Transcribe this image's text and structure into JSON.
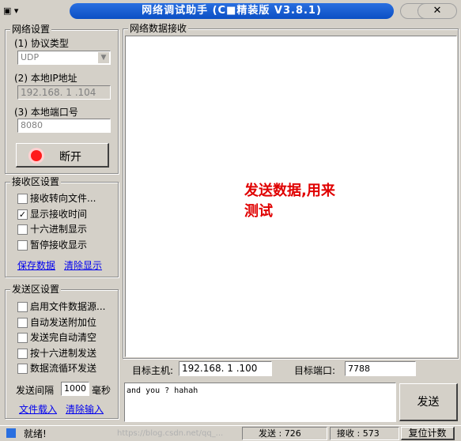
{
  "window": {
    "title": "网络调试助手 (C■精装版 V3.8.1)",
    "app_icon": "▣ ▾",
    "btn_back": "⬅",
    "btn_close": "✕"
  },
  "network": {
    "group_label": "网络设置",
    "protocol_label": "(1) 协议类型",
    "protocol_value": "UDP",
    "ip_label": "(2) 本地IP地址",
    "ip_value": "192.168. 1 .104",
    "port_label": "(3) 本地端口号",
    "port_value": "8080",
    "connect_button": "断开"
  },
  "receive": {
    "group_label": "接收区设置",
    "options": [
      {
        "label": "接收转向文件...",
        "checked": false
      },
      {
        "label": "显示接收时间",
        "checked": true
      },
      {
        "label": "十六进制显示",
        "checked": false
      },
      {
        "label": "暂停接收显示",
        "checked": false
      }
    ],
    "save_link": "保存数据",
    "clear_link": "清除显示"
  },
  "send": {
    "group_label": "发送区设置",
    "options": [
      {
        "label": "启用文件数据源...",
        "checked": false
      },
      {
        "label": "自动发送附加位",
        "checked": false
      },
      {
        "label": "发送完自动清空",
        "checked": false
      },
      {
        "label": "按十六进制发送",
        "checked": false
      },
      {
        "label": "数据流循环发送",
        "checked": false
      }
    ],
    "interval_label": "发送间隔",
    "interval_value": "1000",
    "interval_unit": "毫秒",
    "load_link": "文件载入",
    "clear_link": "清除输入"
  },
  "recv_area": {
    "group_label": "网络数据接收",
    "message_line1": "发送数据,用来",
    "message_line2": "测试"
  },
  "target": {
    "host_label": "目标主机:",
    "host_value": "192.168. 1 .100",
    "port_label": "目标端口:",
    "port_value": "7788"
  },
  "send_area": {
    "text": "and you ? hahah",
    "send_button": "发送"
  },
  "statusbar": {
    "ready": "就绪!",
    "sent_label": "发送 : 726",
    "recv_label": "接收 : 573",
    "reset_button": "复位计数",
    "watermark": "https://blog.csdn.net/qq_..."
  }
}
